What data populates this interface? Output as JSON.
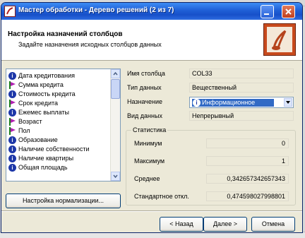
{
  "window": {
    "title": "Мастер обработки - Дерево решений (2 из 7)",
    "accent_color": "#1f5fd6"
  },
  "header": {
    "title": "Настройка назначений столбцов",
    "subtitle": "Задайте назначения исходных столбцов данных"
  },
  "columns_list": [
    {
      "label": "Дата кредитования",
      "icon": "info-icon"
    },
    {
      "label": "Сумма кредита",
      "icon": "target-flag-icon"
    },
    {
      "label": "Стоимость кредита",
      "icon": "info-icon"
    },
    {
      "label": "Срок кредита",
      "icon": "target-flag-icon"
    },
    {
      "label": "Ежемес выплаты",
      "icon": "info-icon"
    },
    {
      "label": "Возраст",
      "icon": "target-flag-icon"
    },
    {
      "label": "Пол",
      "icon": "target-flag-icon"
    },
    {
      "label": "Образование",
      "icon": "info-icon"
    },
    {
      "label": "Наличие собственности",
      "icon": "info-icon"
    },
    {
      "label": "Наличие квартиры",
      "icon": "info-icon"
    },
    {
      "label": "Общая площадь",
      "icon": "info-icon"
    }
  ],
  "normalization_button": "Настройка нормализации...",
  "properties": {
    "column_name_label": "Имя столбца",
    "column_name_value": "COL33",
    "data_type_label": "Тип данных",
    "data_type_value": "Вещественный",
    "purpose_label": "Назначение",
    "purpose_value": "Информационное",
    "data_kind_label": "Вид данных",
    "data_kind_value": "Непрерывный"
  },
  "statistics": {
    "title": "Статистика",
    "min_label": "Минимум",
    "min_value": "0",
    "max_label": "Максимум",
    "max_value": "1",
    "mean_label": "Среднее",
    "mean_value": "0,342657342657343",
    "std_label": "Стандартное откл.",
    "std_value": "0,474598027998801"
  },
  "footer": {
    "back": "< Назад",
    "next": "Далее >",
    "cancel": "Отмена"
  }
}
